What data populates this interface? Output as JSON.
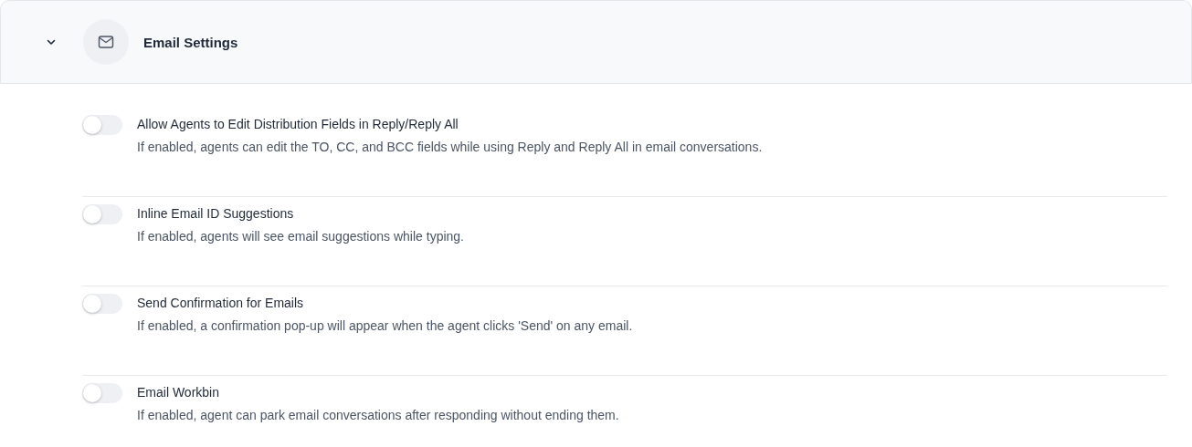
{
  "section": {
    "title": "Email Settings",
    "expanded": true
  },
  "settings": [
    {
      "title": "Allow Agents to Edit Distribution Fields in Reply/Reply All",
      "description": "If enabled, agents can edit the TO, CC, and BCC fields while using Reply and Reply All in email conversations.",
      "on": false
    },
    {
      "title": "Inline Email ID Suggestions",
      "description": "If enabled, agents will see email suggestions while typing.",
      "on": false
    },
    {
      "title": "Send Confirmation for Emails",
      "description": "If enabled, a confirmation pop-up will appear when the agent clicks 'Send' on any email.",
      "on": false
    },
    {
      "title": "Email Workbin",
      "description": "If enabled, agent can park email conversations after responding without ending them.",
      "on": false
    }
  ]
}
